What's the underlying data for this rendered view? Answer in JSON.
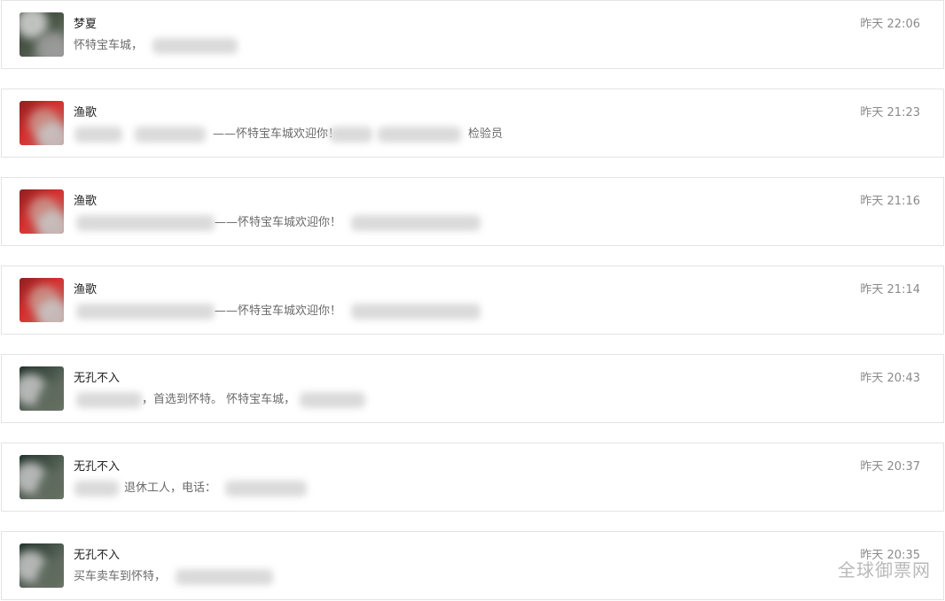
{
  "watermark_text": "全球御票网",
  "messages": [
    {
      "name": "梦夏",
      "time": "昨天 22:06",
      "preview": "怀特宝车城，",
      "avatar_palette": [
        "#2f3a31",
        "#8d8d8d",
        "#4f5a4f"
      ]
    },
    {
      "name": "渔歌",
      "time": "昨天 21:23",
      "preview": "——怀特宝车城欢迎你！",
      "preview_suffix": "检验员",
      "avatar_palette": [
        "#d62f2f",
        "#b46f6a",
        "#8b2a2a"
      ]
    },
    {
      "name": "渔歌",
      "time": "昨天 21:16",
      "preview": "——怀特宝车城欢迎你！",
      "avatar_palette": [
        "#d62f2f",
        "#b46f6a",
        "#8b2a2a"
      ]
    },
    {
      "name": "渔歌",
      "time": "昨天 21:14",
      "preview": "——怀特宝车城欢迎你！",
      "avatar_palette": [
        "#d62f2f",
        "#b46f6a",
        "#8b2a2a"
      ]
    },
    {
      "name": "无孔不入",
      "time": "昨天 20:43",
      "preview": "，首选到怀特。 怀特宝车城，",
      "avatar_palette": [
        "#283227",
        "#7a7a70",
        "#49574c"
      ]
    },
    {
      "name": "无孔不入",
      "time": "昨天 20:37",
      "preview": "退休工人，电话：",
      "avatar_palette": [
        "#283227",
        "#7a7a70",
        "#49574c"
      ]
    },
    {
      "name": "无孔不入",
      "time": "昨天 20:35",
      "preview": "买车卖车到怀特，",
      "avatar_palette": [
        "#283227",
        "#7a7a70",
        "#49574c"
      ]
    }
  ]
}
